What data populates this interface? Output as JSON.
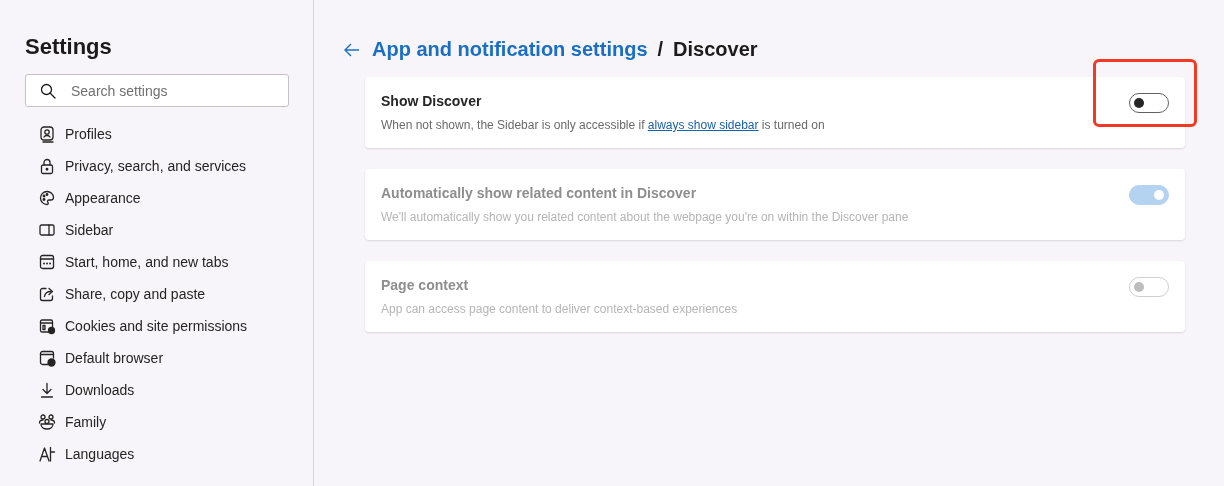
{
  "sidebar": {
    "title": "Settings",
    "search": {
      "placeholder": "Search settings"
    },
    "items": [
      {
        "label": "Profiles",
        "selected": false
      },
      {
        "label": "Privacy, search, and services",
        "selected": false
      },
      {
        "label": "Appearance",
        "selected": false
      },
      {
        "label": "Sidebar",
        "selected": false
      },
      {
        "label": "Start, home, and new tabs",
        "selected": false
      },
      {
        "label": "Share, copy and paste",
        "selected": false
      },
      {
        "label": "Cookies and site permissions",
        "selected": false
      },
      {
        "label": "Default browser",
        "selected": false
      },
      {
        "label": "Downloads",
        "selected": false
      },
      {
        "label": "Family",
        "selected": false
      },
      {
        "label": "Languages",
        "selected": false
      }
    ]
  },
  "header": {
    "breadcrumb_link": "App and notification settings",
    "separator": "/",
    "current": "Discover"
  },
  "settings": [
    {
      "title": "Show Discover",
      "description": "When not shown, the Sidebar is only accessible if ",
      "link": "always show sidebar",
      "description_after": " is turned on",
      "on": false,
      "disabled": false,
      "highlighted": true
    },
    {
      "title": "Automatically show related content in Discover",
      "description": "We'll automatically show you related content about the webpage you're on within the Discover pane",
      "on": true,
      "disabled": true,
      "highlighted": false
    },
    {
      "title": "Page context",
      "description": "App can access page content to deliver context-based experiences",
      "on": false,
      "disabled": true,
      "highlighted": false
    }
  ]
}
